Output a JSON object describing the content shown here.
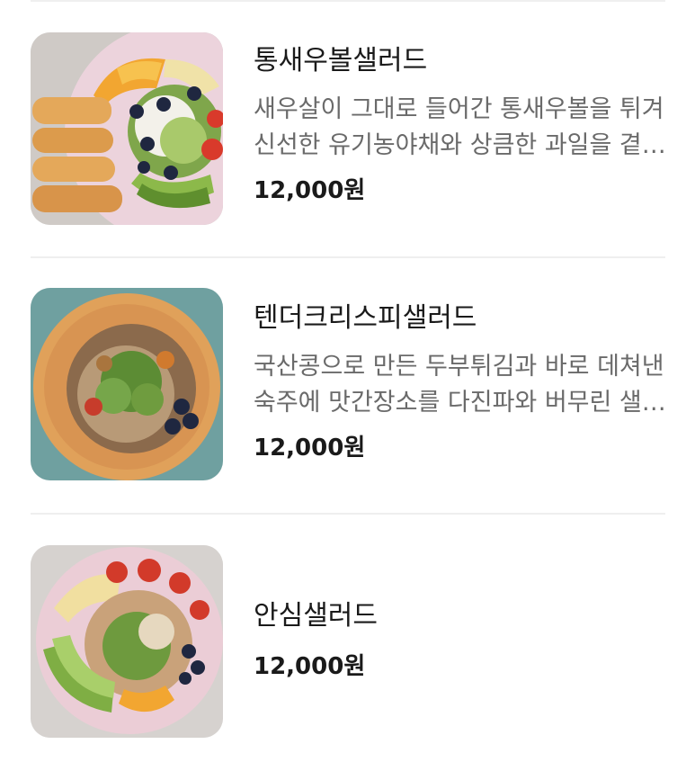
{
  "menu": {
    "items": [
      {
        "image": "shrimp-salad-photo",
        "name": "통새우볼샐러드",
        "description": "새우살이 그대로 들어간 통새우볼을 튀겨 신선한 유기농야채와 상큼한 과일을 곁들인 샐러드",
        "price": "12,000원"
      },
      {
        "image": "tender-crispy-salad-photo",
        "name": "텐더크리스피샐러드",
        "description": "국산콩으로 만든 두부튀김과 바로 데쳐낸 숙주에 맛간장소를 다진파와 버무린 샐러드",
        "price": "12,000원"
      },
      {
        "image": "ansim-salad-photo",
        "name": "안심샐러드",
        "description": "",
        "price": "12,000원"
      }
    ]
  }
}
